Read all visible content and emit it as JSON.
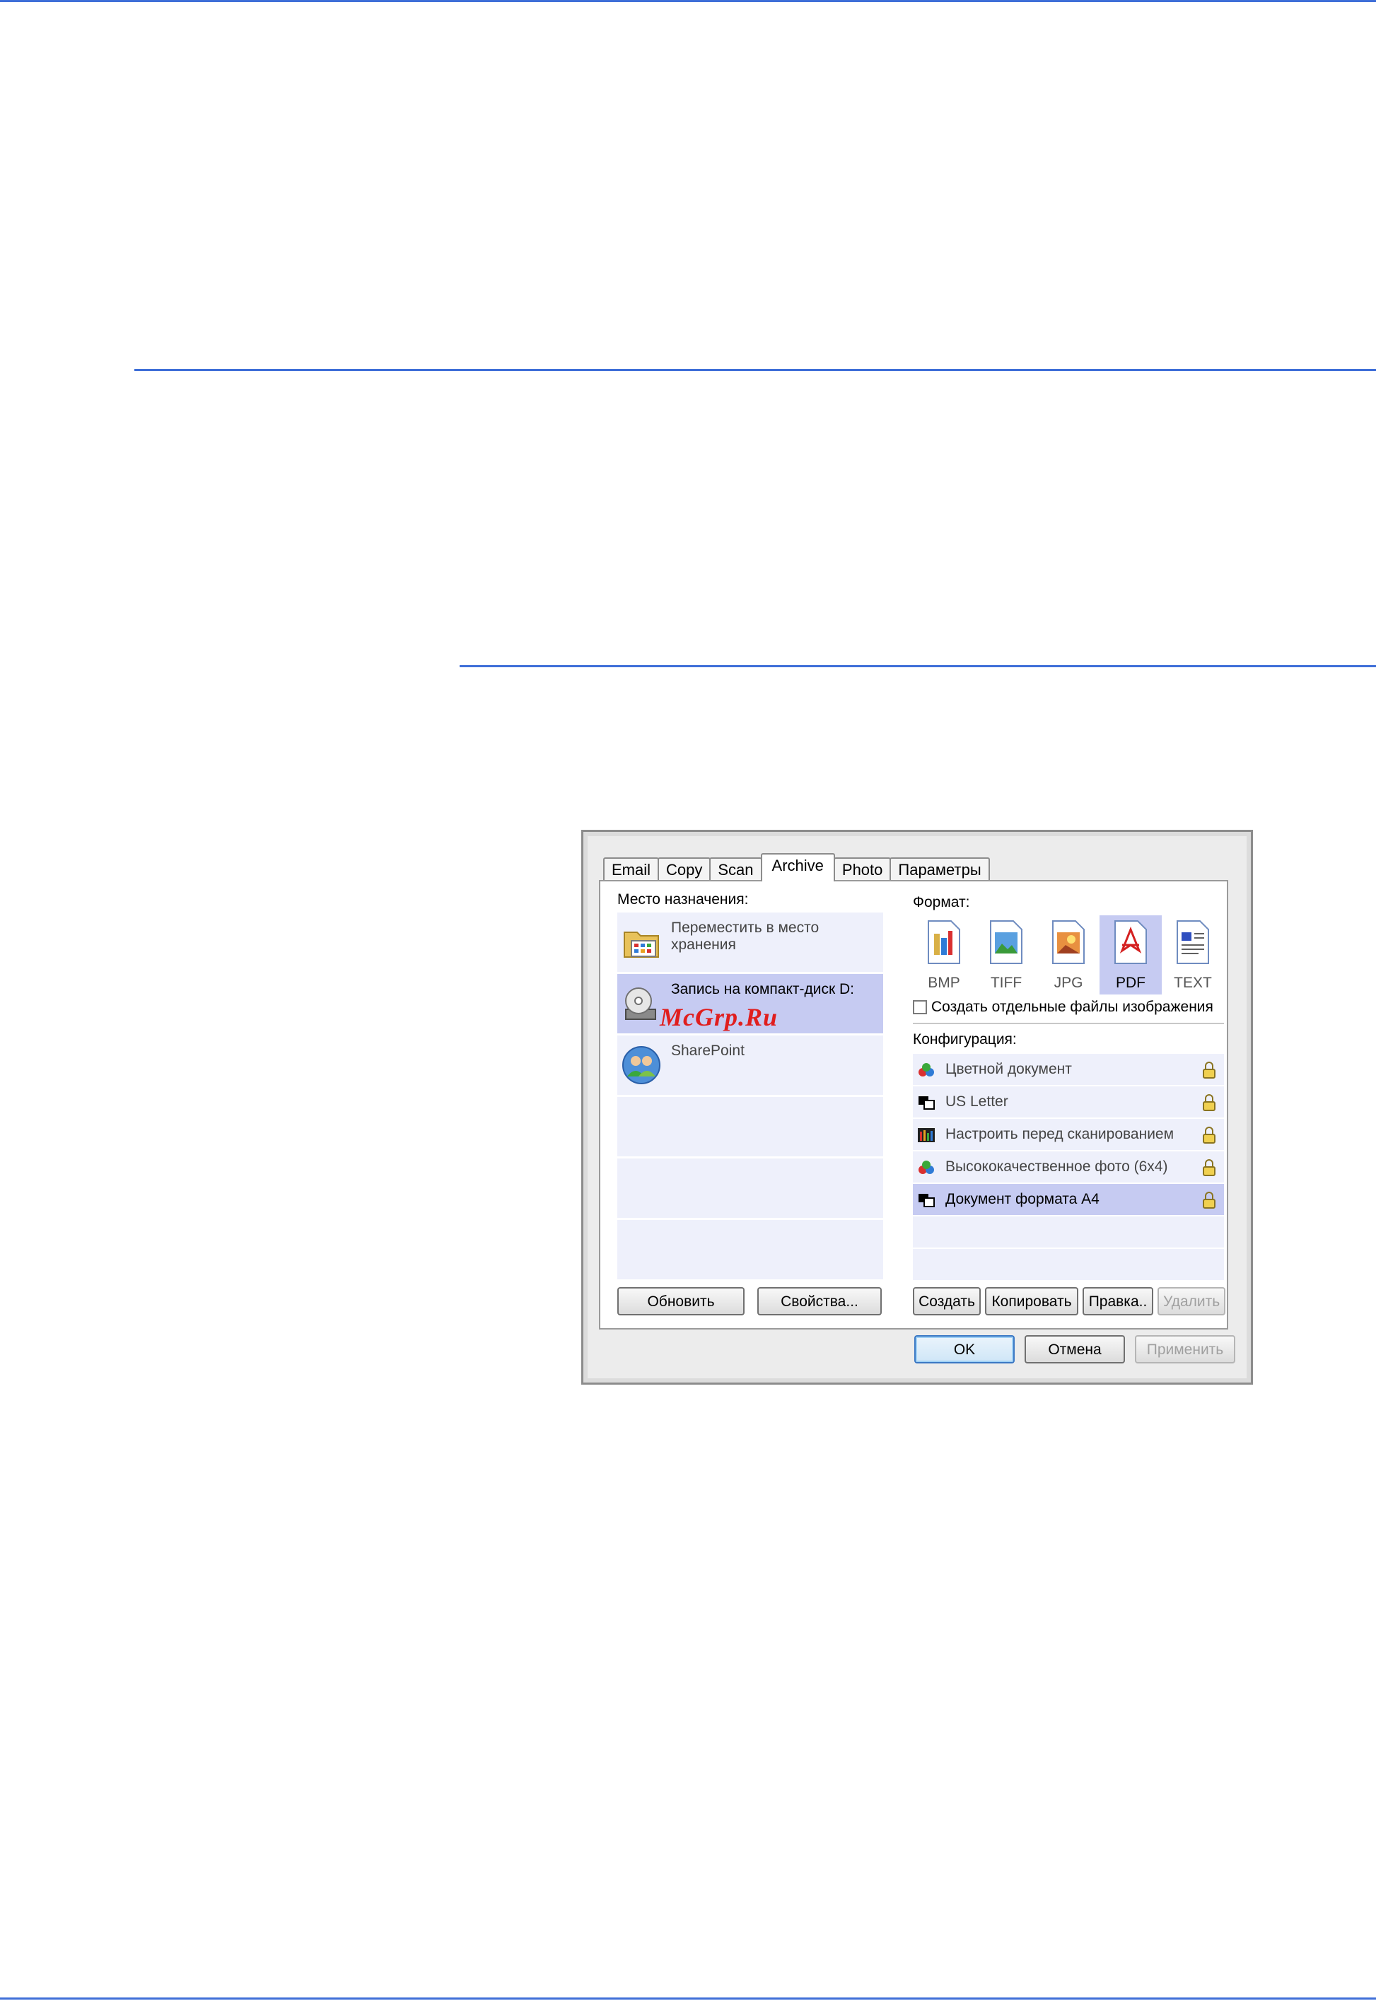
{
  "dialog": {
    "tabs": [
      {
        "label": "Email"
      },
      {
        "label": "Copy"
      },
      {
        "label": "Scan"
      },
      {
        "label": "Archive"
      },
      {
        "label": "Photo"
      },
      {
        "label": "Параметры"
      }
    ],
    "active_tab": "Archive",
    "destination": {
      "heading": "Место назначения:",
      "items": [
        {
          "label": "Переместить в место хранения",
          "icon": "storage-folder-icon"
        },
        {
          "label": "Запись на компакт-диск  D:",
          "icon": "cd-burner-icon",
          "selected": true
        },
        {
          "label": "SharePoint",
          "icon": "sharepoint-users-icon"
        }
      ],
      "watermark": "McGrp.Ru"
    },
    "format": {
      "heading": "Формат:",
      "items": [
        {
          "label": "BMP"
        },
        {
          "label": "TIFF"
        },
        {
          "label": "JPG"
        },
        {
          "label": "PDF",
          "selected": true
        },
        {
          "label": "TEXT"
        }
      ],
      "separate_files_label": "Создать отдельные файлы изображения"
    },
    "configuration": {
      "heading": "Конфигурация:",
      "items": [
        {
          "label": "Цветной документ",
          "icon": "color-document-icon"
        },
        {
          "label": "US Letter",
          "icon": "bw-document-icon"
        },
        {
          "label": "Настроить перед сканированием",
          "icon": "configure-scan-icon"
        },
        {
          "label": "Высококачественное фото (6x4)",
          "icon": "color-photo-icon"
        },
        {
          "label": "Документ формата A4",
          "icon": "bw-document-icon",
          "selected": true
        }
      ]
    },
    "buttons": {
      "refresh": "Обновить",
      "properties": "Свойства...",
      "create": "Создать",
      "copy": "Копировать",
      "edit": "Правка..",
      "delete": "Удалить",
      "ok": "OK",
      "cancel": "Отмена",
      "apply": "Применить"
    },
    "colors": {
      "selection": "#c6cbf2",
      "list_background": "#eef0fb",
      "rule_blue": "#3f6fd8"
    }
  }
}
